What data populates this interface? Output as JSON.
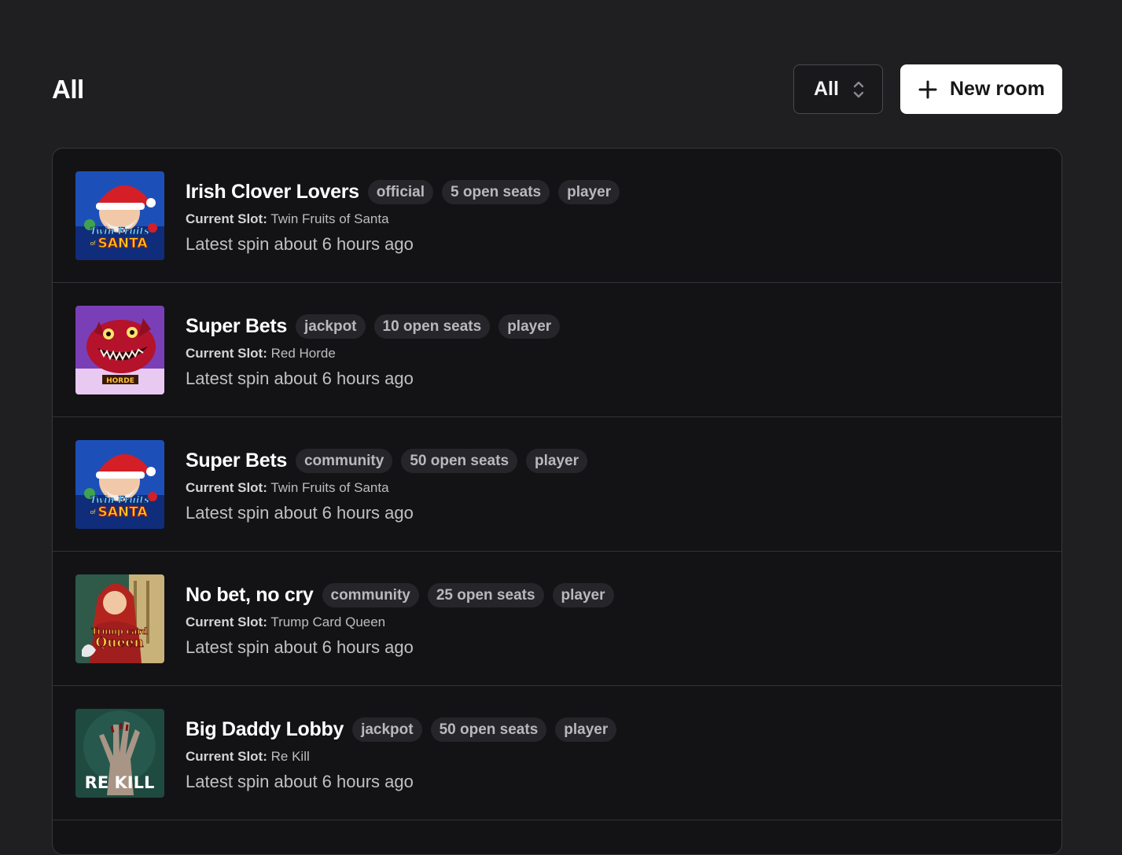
{
  "header": {
    "title": "All",
    "filter": {
      "selected": "All"
    },
    "new_room_label": "New room"
  },
  "rooms": [
    {
      "name": "Irish Clover Lovers",
      "badges": [
        "official",
        "5 open seats",
        "player"
      ],
      "slot_label": "Current Slot:",
      "slot": "Twin Fruits of Santa",
      "latest_spin": "Latest spin about 6 hours ago",
      "thumb": "santa"
    },
    {
      "name": "Super Bets",
      "badges": [
        "jackpot",
        "10 open seats",
        "player"
      ],
      "slot_label": "Current Slot:",
      "slot": "Red Horde",
      "latest_spin": "Latest spin about 6 hours ago",
      "thumb": "horde"
    },
    {
      "name": "Super Bets",
      "badges": [
        "community",
        "50 open seats",
        "player"
      ],
      "slot_label": "Current Slot:",
      "slot": "Twin Fruits of Santa",
      "latest_spin": "Latest spin about 6 hours ago",
      "thumb": "santa"
    },
    {
      "name": "No bet, no cry",
      "badges": [
        "community",
        "25 open seats",
        "player"
      ],
      "slot_label": "Current Slot:",
      "slot": "Trump Card Queen",
      "latest_spin": "Latest spin about 6 hours ago",
      "thumb": "queen"
    },
    {
      "name": "Big Daddy Lobby",
      "badges": [
        "jackpot",
        "50 open seats",
        "player"
      ],
      "slot_label": "Current Slot:",
      "slot": "Re Kill",
      "latest_spin": "Latest spin about 6 hours ago",
      "thumb": "rekill"
    }
  ],
  "thumb_text": {
    "santa": [
      "Twin Fruits",
      "of",
      "SANTA"
    ],
    "horde": [
      "HORDE"
    ],
    "queen": [
      "Trump card",
      "Queen"
    ],
    "rekill": [
      "RE KILL"
    ]
  },
  "colors": {
    "background": "#1f1f21",
    "panel": "#131315",
    "badge": "#26262a",
    "button": "#ffffff"
  }
}
